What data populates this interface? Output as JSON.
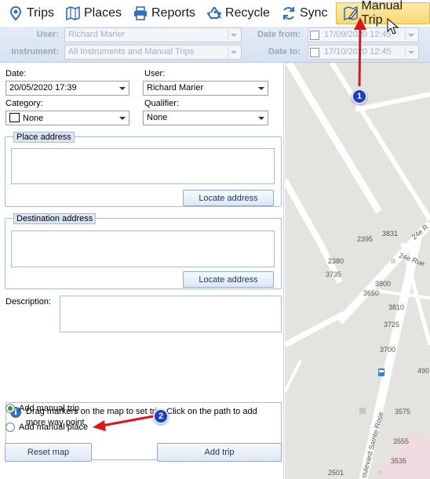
{
  "toolbar": {
    "trips": "Trips",
    "places": "Places",
    "reports": "Reports",
    "recycle": "Recycle",
    "sync": "Sync",
    "manual_trip": "Manual Trip"
  },
  "filter": {
    "user_label": "User:",
    "user_value": "Richard Marier",
    "instrument_label": "Instrument:",
    "instrument_value": "All Instruments and Manual Trips",
    "date_from_label": "Date from:",
    "date_from_value": "17/09/2020 12:45",
    "date_to_label": "Date to:",
    "date_to_value": "17/10/2020 12:45"
  },
  "form": {
    "date_label": "Date:",
    "date_value": "20/05/2020 17:39",
    "user_label": "User:",
    "user_value": "Richard Marier",
    "category_label": "Category:",
    "category_value": "None",
    "qualifier_label": "Qualifier:",
    "qualifier_value": "None",
    "place_address_title": "Place address",
    "destination_address_title": "Destination address",
    "locate_address_label": "Locate address",
    "description_label": "Description:",
    "info_text": "Drag markers on the map to set trip. Click on the path to add more way point.",
    "add_manual_trip": "Add manual trip",
    "add_manual_place": "Add manual place",
    "reset_map": "Reset map",
    "add_trip": "Add trip"
  },
  "map": {
    "labels": [
      "3831",
      "24e R",
      "2395",
      "2380",
      "3735",
      "24e Rue",
      "3800",
      "3650",
      "3810",
      "3725",
      "3700",
      "490",
      "3575",
      "3555",
      "3535",
      "2501",
      "oulevard Sainte-Rose"
    ]
  },
  "callouts": {
    "one": "1",
    "two": "2"
  },
  "colors": {
    "accent": "#1f3fbf",
    "arrow": "#e0141b",
    "active_tab": "#fbd978",
    "toolbar_icon": "#2e6fbf"
  }
}
